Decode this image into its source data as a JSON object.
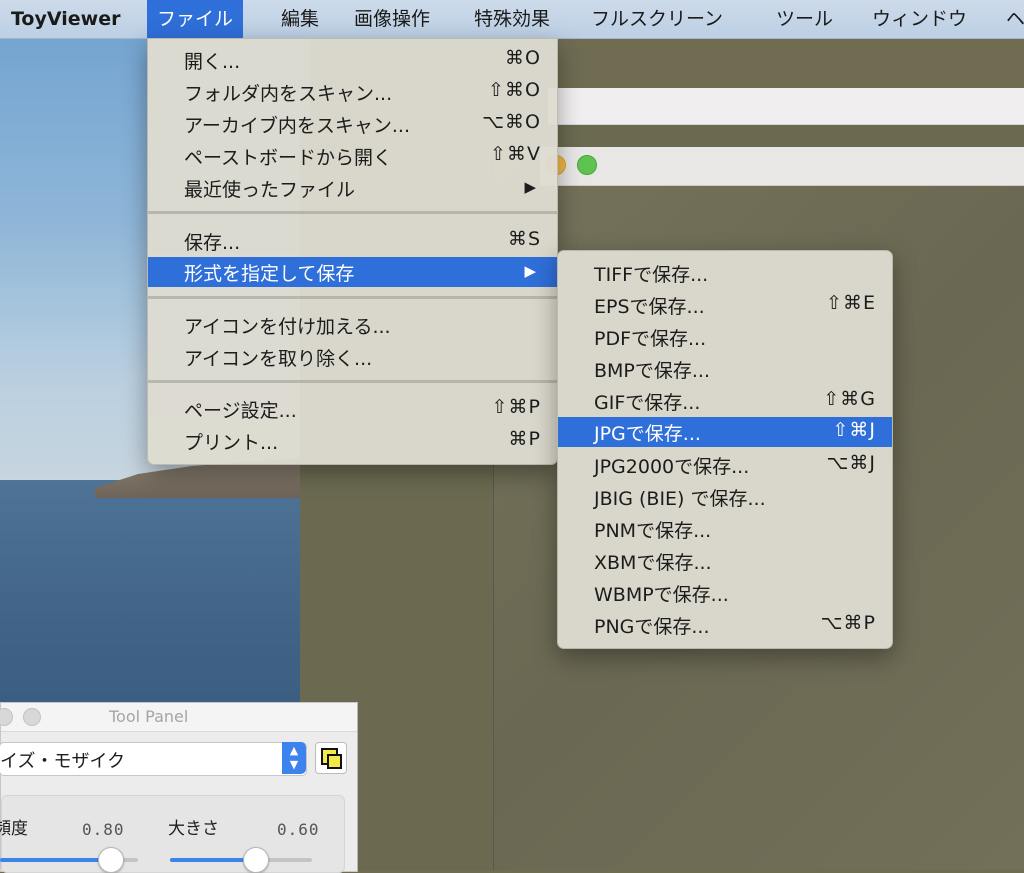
{
  "menubar": {
    "app_name": "ToyViewer",
    "items": [
      "ファイル",
      "編集",
      "画像操作",
      "特殊効果",
      "フルスクリーン",
      "ツール",
      "ウィンドウ",
      "ヘ"
    ]
  },
  "file_menu": {
    "items": [
      {
        "label": "開く...",
        "shortcut": "⌘O"
      },
      {
        "label": "フォルダ内をスキャン...",
        "shortcut": "⇧⌘O"
      },
      {
        "label": "アーカイブ内をスキャン...",
        "shortcut": "⌥⌘O"
      },
      {
        "label": "ペーストボードから開く",
        "shortcut": "⇧⌘V"
      },
      {
        "label": "最近使ったファイル",
        "shortcut": "▶"
      },
      {
        "label": "保存...",
        "shortcut": "⌘S"
      },
      {
        "label": "形式を指定して保存",
        "shortcut": "▶"
      },
      {
        "label": "アイコンを付け加える...",
        "shortcut": ""
      },
      {
        "label": "アイコンを取り除く...",
        "shortcut": ""
      },
      {
        "label": "ページ設定...",
        "shortcut": "⇧⌘P"
      },
      {
        "label": "プリント...",
        "shortcut": "⌘P"
      }
    ]
  },
  "format_menu": {
    "items": [
      {
        "label": "TIFFで保存...",
        "shortcut": ""
      },
      {
        "label": "EPSで保存...",
        "shortcut": "⇧⌘E"
      },
      {
        "label": "PDFで保存...",
        "shortcut": ""
      },
      {
        "label": "BMPで保存...",
        "shortcut": ""
      },
      {
        "label": "GIFで保存...",
        "shortcut": "⇧⌘G"
      },
      {
        "label": "JPGで保存...",
        "shortcut": "⇧⌘J"
      },
      {
        "label": "JPG2000で保存...",
        "shortcut": "⌥⌘J"
      },
      {
        "label": "JBIG (BIE) で保存...",
        "shortcut": ""
      },
      {
        "label": "PNMで保存...",
        "shortcut": ""
      },
      {
        "label": "XBMで保存...",
        "shortcut": ""
      },
      {
        "label": "WBMPで保存...",
        "shortcut": ""
      },
      {
        "label": "PNGで保存...",
        "shortcut": "⌥⌘P"
      }
    ]
  },
  "tool_panel": {
    "title": "Tool Panel",
    "effect_select": "イズ・モザイク",
    "sliders": [
      {
        "label": "頻度",
        "value": "0.80",
        "level": 0.8
      },
      {
        "label": "大きさ",
        "value": "0.60",
        "level": 0.6
      }
    ]
  },
  "colors": {
    "menu_highlight": "#2f6fd9",
    "slider_accent": "#3d83ee"
  }
}
